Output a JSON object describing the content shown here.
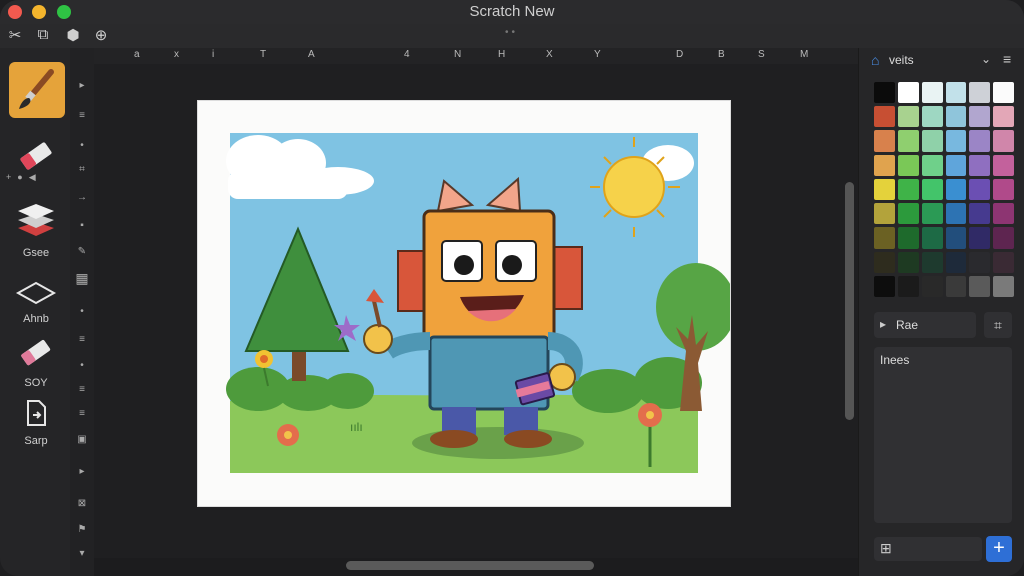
{
  "app": {
    "title": "Scratch New"
  },
  "toolbar": {
    "icons": [
      "scissors-icon",
      "crop-icon",
      "shape-icon",
      "zoom-icon"
    ]
  },
  "left_tools": [
    {
      "name": "brush",
      "label": ""
    },
    {
      "name": "eraser",
      "label": ""
    },
    {
      "name": "layers",
      "label": "Gsee"
    },
    {
      "name": "shape",
      "label": "Ahnb"
    },
    {
      "name": "eraser2",
      "label": "SOY"
    },
    {
      "name": "export",
      "label": "Sarp"
    }
  ],
  "ruler": {
    "marks": [
      "a",
      "x",
      "i",
      "T",
      "A",
      "4",
      "N",
      "H",
      "X",
      "Y",
      "D",
      "B",
      "S",
      "M"
    ]
  },
  "right_panel": {
    "title": "veits",
    "button_label": "Rae",
    "notes_label": "Inees",
    "add_label": "+"
  },
  "colors": {
    "accent_brush": "#e5a33a",
    "add_button": "#2e6fd6",
    "swatches": [
      "#0b0b0b",
      "#ffffff",
      "#e9f3f3",
      "#c2e1ea",
      "#ced1d7",
      "#fbfbfb",
      "#c74f33",
      "#a8d28f",
      "#9ed7c2",
      "#8fc5db",
      "#b1a6cf",
      "#e3a7b7",
      "#d8814c",
      "#8fcf6f",
      "#8fd1a9",
      "#78b8df",
      "#9b85c6",
      "#d086aa",
      "#e0a34e",
      "#7ac857",
      "#6fd08a",
      "#5fa5db",
      "#8f6fc0",
      "#c3619c",
      "#e4d23b",
      "#3fb348",
      "#43c46a",
      "#3a8fd1",
      "#6b4fb3",
      "#b04a8a",
      "#b3a33b",
      "#2c9a3c",
      "#2b9a55",
      "#2d73b3",
      "#463a8f",
      "#8d3572",
      "#6b6123",
      "#1e6a2c",
      "#1d6a45",
      "#224e7c",
      "#302a66",
      "#5e2550",
      "#2e2c1e",
      "#1e3a22",
      "#1e3a2e",
      "#1e2a3a",
      "#2a2a2e",
      "#3a2a34",
      "#0d0d0d",
      "#1b1b1b",
      "#292929",
      "#3a3a3a",
      "#5a5a5a",
      "#7a7a7a"
    ]
  }
}
